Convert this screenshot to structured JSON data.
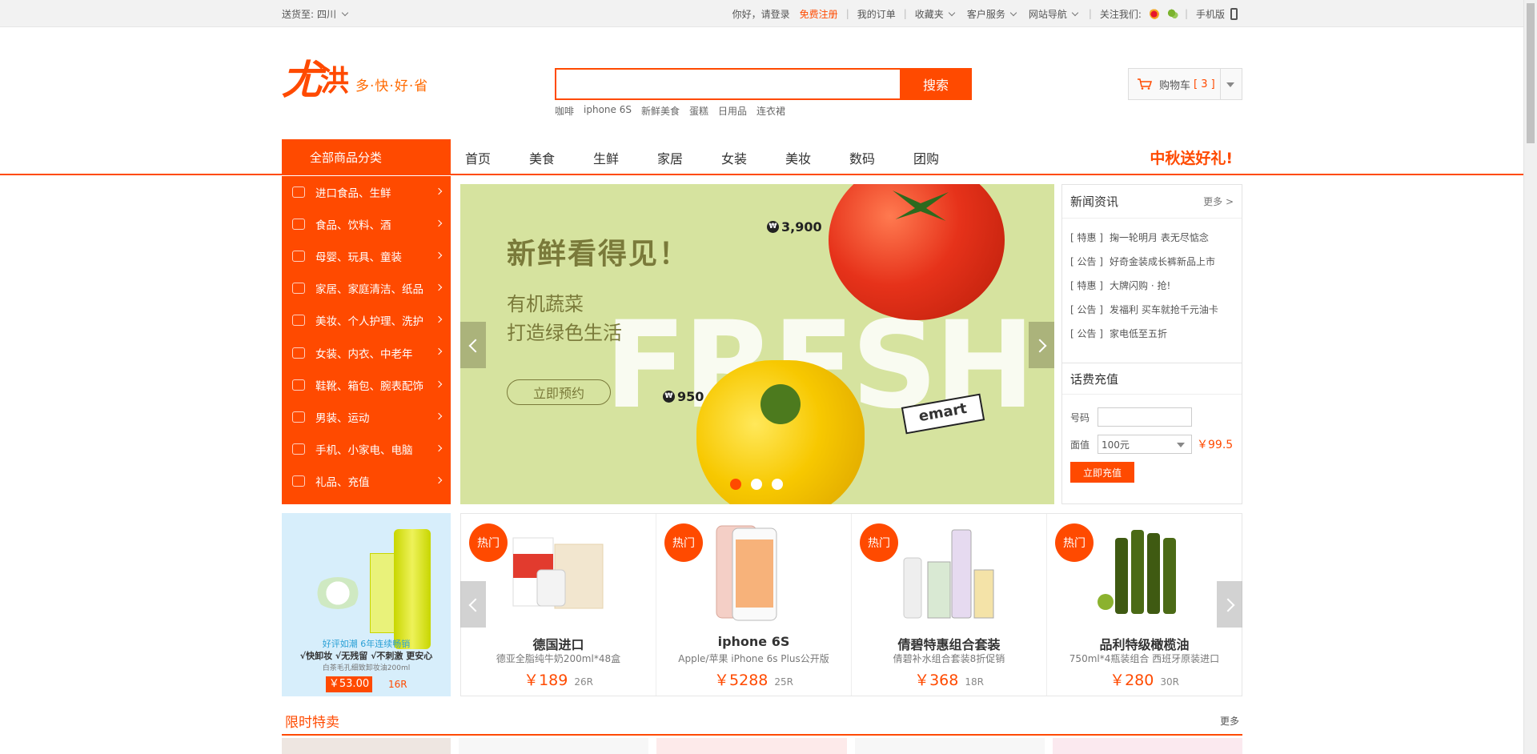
{
  "topbar": {
    "ship_to_label": "送货至:",
    "ship_to_value": "四川",
    "greeting": "你好，请登录",
    "register": "免费注册",
    "my_orders": "我的订单",
    "favorites": "收藏夹",
    "customer_service": "客户服务",
    "site_nav": "网站导航",
    "follow_us": "关注我们:",
    "mobile": "手机版"
  },
  "logo": {
    "char1": "尤",
    "char2": "洪",
    "slogan": "多·快·好·省"
  },
  "search": {
    "placeholder": "",
    "button": "搜索",
    "hotwords": [
      "咖啡",
      "iphone 6S",
      "新鲜美食",
      "蛋糕",
      "日用品",
      "连衣裙"
    ]
  },
  "cart": {
    "label": "购物车",
    "count_text": "[ 3 ]"
  },
  "nav": {
    "all_categories": "全部商品分类",
    "items": [
      "首页",
      "美食",
      "生鲜",
      "家居",
      "女装",
      "美妆",
      "数码",
      "团购"
    ],
    "promo": "中秋送好礼!"
  },
  "categories": [
    {
      "label": "进口食品、生鲜",
      "icon": "imported-food-icon"
    },
    {
      "label": "食品、饮料、酒",
      "icon": "beverage-icon"
    },
    {
      "label": "母婴、玩具、童装",
      "icon": "baby-icon"
    },
    {
      "label": "家居、家庭清洁、纸品",
      "icon": "home-icon"
    },
    {
      "label": "美妆、个人护理、洗护",
      "icon": "cosmetics-icon"
    },
    {
      "label": "女装、内衣、中老年",
      "icon": "dress-icon"
    },
    {
      "label": "鞋靴、箱包、腕表配饰",
      "icon": "shoe-icon"
    },
    {
      "label": "男装、运动",
      "icon": "shirt-icon"
    },
    {
      "label": "手机、小家电、电脑",
      "icon": "phone-icon"
    },
    {
      "label": "礼品、充值",
      "icon": "card-icon"
    }
  ],
  "banner": {
    "headline": "新鲜看得见！",
    "sub1": "有机蔬菜",
    "sub2": "打造绿色生活",
    "cta": "立即预约",
    "big_word": "FRESH",
    "price_tomato": "3,900",
    "price_pepper": "950",
    "won_symbol": "₩",
    "brand": "emart",
    "active_slide": 1,
    "slides": 3
  },
  "news": {
    "title": "新闻资讯",
    "more": "更多 >",
    "items": [
      {
        "tag": "[ 特惠 ]",
        "text": "掬一轮明月 表无尽惦念"
      },
      {
        "tag": "[ 公告 ]",
        "text": "好奇金装成长裤新品上市"
      },
      {
        "tag": "[ 特惠 ]",
        "text": "大牌闪购 · 抢!"
      },
      {
        "tag": "[ 公告 ]",
        "text": "发福利 买车就抢千元油卡"
      },
      {
        "tag": "[ 公告 ]",
        "text": "家电低至五折"
      }
    ]
  },
  "recharge": {
    "title": "话费充值",
    "number_label": "号码",
    "number_value": "",
    "face_label": "面值",
    "face_value": "100元",
    "price": "￥99.5",
    "button": "立即充值"
  },
  "left_ad": {
    "line1": "好评如潮 6年连续畅销",
    "line2": "√快卸妆 √无残留 √不刺激 更安心",
    "line3": "白茶毛孔细致卸妆油200ml",
    "price": "￥53.00",
    "sold": "16R"
  },
  "products": [
    {
      "badge": "热门",
      "name": "德国进口",
      "desc": "德亚全脂纯牛奶200ml*48盒",
      "price": "￥189",
      "sold": "26R"
    },
    {
      "badge": "热门",
      "name": "iphone 6S",
      "desc": "Apple/苹果 iPhone 6s Plus公开版",
      "price": "￥5288",
      "sold": "25R"
    },
    {
      "badge": "热门",
      "name": "倩碧特惠组合套装",
      "desc": "倩碧补水组合套装8折促销",
      "price": "￥368",
      "sold": "18R"
    },
    {
      "badge": "热门",
      "name": "品利特级橄榄油",
      "desc": "750ml*4瓶装组合 西班牙原装进口",
      "price": "￥280",
      "sold": "30R"
    }
  ],
  "section": {
    "title": "限时特卖",
    "more": "更多"
  },
  "colors": {
    "accent": "#ff4a00",
    "banner_bg": "#d6e39f"
  }
}
